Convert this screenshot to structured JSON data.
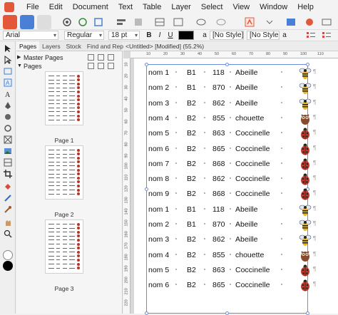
{
  "menu": [
    "File",
    "Edit",
    "Document",
    "Text",
    "Table",
    "Layer",
    "Select",
    "View",
    "Window",
    "Help"
  ],
  "context": {
    "font_family": "Arial",
    "font_style": "Regular",
    "font_size": "18 pt",
    "bold": "B",
    "italic": "I",
    "underline": "U",
    "style1": "[No Style]",
    "style2": "[No Style]",
    "a_glyph": "a"
  },
  "panel": {
    "tabs": [
      "Pages",
      "Layers",
      "Stock",
      "Find and Replace"
    ],
    "master_pages": "Master Pages",
    "pages": "Pages",
    "page_labels": [
      "Page 1",
      "Page 2",
      "Page 3"
    ]
  },
  "document": {
    "tab_title": "<Untitled> [Modified] (55.2%)",
    "ruler_h": [
      "10",
      "20",
      "30",
      "40",
      "50",
      "60",
      "70",
      "80",
      "90",
      "100",
      "110"
    ],
    "ruler_v": [
      "10",
      "20",
      "30",
      "40",
      "50",
      "60",
      "70",
      "80",
      "90",
      "100",
      "110",
      "120",
      "130",
      "140",
      "150",
      "160",
      "170",
      "180",
      "190",
      "200",
      "210",
      "220"
    ],
    "pilcrow": "¶",
    "rows": [
      {
        "name": "nom 1",
        "code": "B1",
        "num": "118",
        "insect": "Abeille",
        "icon": "bee"
      },
      {
        "name": "nom 2",
        "code": "B1",
        "num": "870",
        "insect": "Abeille",
        "icon": "bee"
      },
      {
        "name": "nom 3",
        "code": "B2",
        "num": "862",
        "insect": "Abeille",
        "icon": "bee"
      },
      {
        "name": "nom 4",
        "code": "B2",
        "num": "855",
        "insect": "chouette",
        "icon": "owl"
      },
      {
        "name": "nom 5",
        "code": "B2",
        "num": "863",
        "insect": "Coccinelle",
        "icon": "ladybug"
      },
      {
        "name": "nom 6",
        "code": "B2",
        "num": "865",
        "insect": "Coccinelle",
        "icon": "ladybug"
      },
      {
        "name": "nom 7",
        "code": "B2",
        "num": "868",
        "insect": "Coccinelle",
        "icon": "ladybug"
      },
      {
        "name": "nom 8",
        "code": "B2",
        "num": "862",
        "insect": "Coccinelle",
        "icon": "ladybug"
      },
      {
        "name": "nom 9",
        "code": "B2",
        "num": "868",
        "insect": "Coccinelle",
        "icon": "ladybug"
      },
      {
        "name": "nom 1",
        "code": "B1",
        "num": "118",
        "insect": "Abeille",
        "icon": "bee"
      },
      {
        "name": "nom 2",
        "code": "B1",
        "num": "870",
        "insect": "Abeille",
        "icon": "bee"
      },
      {
        "name": "nom 3",
        "code": "B2",
        "num": "862",
        "insect": "Abeille",
        "icon": "bee"
      },
      {
        "name": "nom 4",
        "code": "B2",
        "num": "855",
        "insect": "chouette",
        "icon": "owl"
      },
      {
        "name": "nom 5",
        "code": "B2",
        "num": "863",
        "insect": "Coccinelle",
        "icon": "ladybug"
      },
      {
        "name": "nom 6",
        "code": "B2",
        "num": "865",
        "insect": "Coccinelle",
        "icon": "ladybug"
      }
    ]
  },
  "colors": {
    "accent": "#e4583a",
    "selection": "#6a8fd8",
    "ladybug": "#c0392b",
    "bee": "#e8b923",
    "owl": "#8b4a2b"
  }
}
